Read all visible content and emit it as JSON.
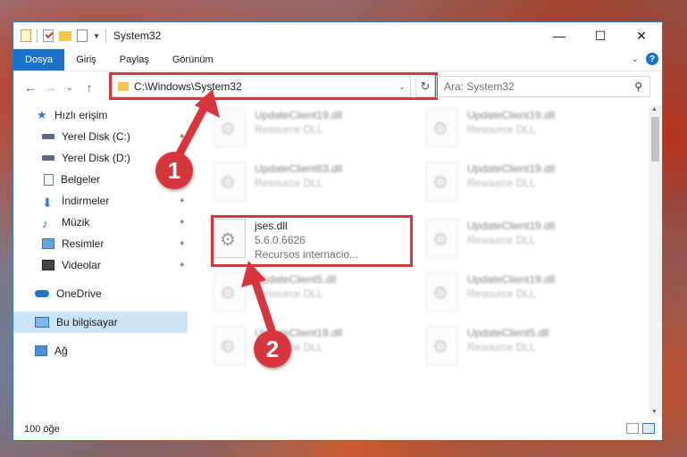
{
  "window": {
    "title": "System32",
    "controls": {
      "minimize": "—",
      "maximize": "☐",
      "close": "✕"
    }
  },
  "ribbon": {
    "tabs": [
      "Dosya",
      "Giriş",
      "Paylaş",
      "Görünüm"
    ],
    "help": "?"
  },
  "nav": {
    "back": "←",
    "forward": "→",
    "recent": "⌄",
    "up": "↑",
    "address": "C:\\Windows\\System32",
    "refresh": "↻",
    "search_placeholder": "Ara: System32"
  },
  "sidebar": {
    "items": [
      {
        "label": "Hızlı erişim",
        "icon": "star-icon"
      },
      {
        "label": "Yerel Disk (C:)",
        "icon": "drive-icon",
        "pinned": true
      },
      {
        "label": "Yerel Disk (D:)",
        "icon": "drive-icon"
      },
      {
        "label": "Belgeler",
        "icon": "document-icon"
      },
      {
        "label": "İndirmeler",
        "icon": "download-icon",
        "pinned": true
      },
      {
        "label": "Müzik",
        "icon": "music-icon",
        "pinned": true
      },
      {
        "label": "Resimler",
        "icon": "picture-icon",
        "pinned": true
      },
      {
        "label": "Videolar",
        "icon": "video-icon",
        "pinned": true
      },
      {
        "label": "OneDrive",
        "icon": "cloud-icon"
      },
      {
        "label": "Bu bilgisayar",
        "icon": "computer-icon",
        "selected": true
      },
      {
        "label": "Ağ",
        "icon": "network-icon"
      }
    ]
  },
  "files": [
    {
      "name": "UpdateClient19.dll",
      "sub": "Resource DLL"
    },
    {
      "name": "UpdateClient19.dll",
      "sub": "Resource DLL"
    },
    {
      "name": "UpdateClient63.dll",
      "sub": "Resource DLL"
    },
    {
      "name": "UpdateClient19.dll",
      "sub": "Resource DLL"
    },
    {
      "name": "jses.dll",
      "version": "5.6.0.6626",
      "sub": "Recursos internacio..."
    },
    {
      "name": "UpdateClient19.dll",
      "sub": "Resource DLL"
    },
    {
      "name": "UpdateClient5.dll",
      "sub": "Resource DLL"
    },
    {
      "name": "UpdateClient19.dll",
      "sub": "Resource DLL"
    },
    {
      "name": "UpdateClient19.dll",
      "sub": "Resource DLL"
    },
    {
      "name": "UpdateClient5.dll",
      "sub": "Resource DLL"
    }
  ],
  "status": {
    "count": "100 öğe"
  },
  "annotations": {
    "step1": "1",
    "step2": "2",
    "color": "#d7363d"
  },
  "colors": {
    "accent": "#1b72c9",
    "highlight": "#d7363d",
    "selection": "#cce4f7"
  }
}
